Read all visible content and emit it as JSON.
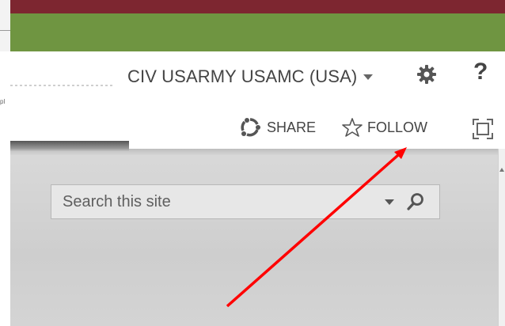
{
  "header": {
    "user_name": "CIV USARMY USAMC (USA)",
    "left_crumb": "pl"
  },
  "actions": {
    "share_label": "SHARE",
    "follow_label": "FOLLOW"
  },
  "search": {
    "placeholder": "Search this site"
  },
  "colors": {
    "suite_bar": "#7d2630",
    "ribbon": "#6f9541",
    "annotation_arrow": "#ff0000"
  },
  "icons": [
    "settings-gear-icon",
    "help-icon",
    "share-icon",
    "follow-star-icon",
    "focus-mode-icon",
    "search-icon"
  ]
}
